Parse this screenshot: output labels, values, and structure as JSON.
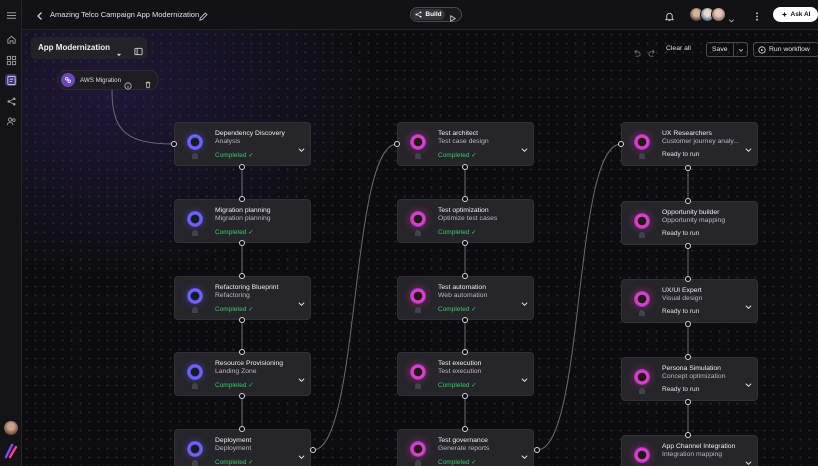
{
  "header": {
    "title": "Amazing Telco Campaign App Modernization",
    "build_label": "Build",
    "ask_ai_label": "Ask AI"
  },
  "panel": {
    "title": "App Modernization",
    "chip_label": "AWS Migration"
  },
  "toolbar": {
    "clear_label": "Clear all",
    "save_label": "Save",
    "run_label": "Run workflow"
  },
  "columns": [
    {
      "nodes": [
        {
          "title": "Dependency Discovery",
          "subtitle": "Analysis",
          "status": "Completed ✓"
        },
        {
          "title": "Migration planning",
          "subtitle": "Migration planning",
          "status": "Completed ✓"
        },
        {
          "title": "Refactoring Blueprint",
          "subtitle": "Refactoring",
          "status": "Completed ✓"
        },
        {
          "title": "Resource Provisioning",
          "subtitle": "Landing Zone",
          "status": "Completed ✓"
        },
        {
          "title": "Deployment",
          "subtitle": "Deployment",
          "status": "Completed ✓"
        }
      ]
    },
    {
      "nodes": [
        {
          "title": "Test architect",
          "subtitle": "Test case design",
          "status": "Completed ✓"
        },
        {
          "title": "Test optimization",
          "subtitle": "Optimize test cases",
          "status": "Completed ✓"
        },
        {
          "title": "Test automation",
          "subtitle": "Web automation",
          "status": "Completed ✓"
        },
        {
          "title": "Test execution",
          "subtitle": "Test execution",
          "status": "Completed ✓"
        },
        {
          "title": "Test governance",
          "subtitle": "Generate reports",
          "status": "Completed ✓"
        }
      ]
    },
    {
      "nodes": [
        {
          "title": "UX Researchers",
          "subtitle": "Customer journey analy...",
          "status": "Ready to run"
        },
        {
          "title": "Opportunity builder",
          "subtitle": "Opportunity mapping",
          "status": "Ready to run"
        },
        {
          "title": "UX/UI Expert",
          "subtitle": "Visual design",
          "status": "Ready to run"
        },
        {
          "title": "Persona Simulation",
          "subtitle": "Concept optimization",
          "status": "Ready to run"
        },
        {
          "title": "App Channel Integration",
          "subtitle": "Integration mapping",
          "status": ""
        }
      ]
    }
  ],
  "colors": {
    "completed": "#3fc96a",
    "accent_blue": "#3d6bff",
    "accent_pink": "#ff3f8e",
    "chip_purple": "#6b46c1"
  },
  "icons": {
    "rail": [
      "menu-icon",
      "home-icon",
      "grid-icon",
      "workflow-icon",
      "share-icon",
      "users-icon"
    ]
  }
}
